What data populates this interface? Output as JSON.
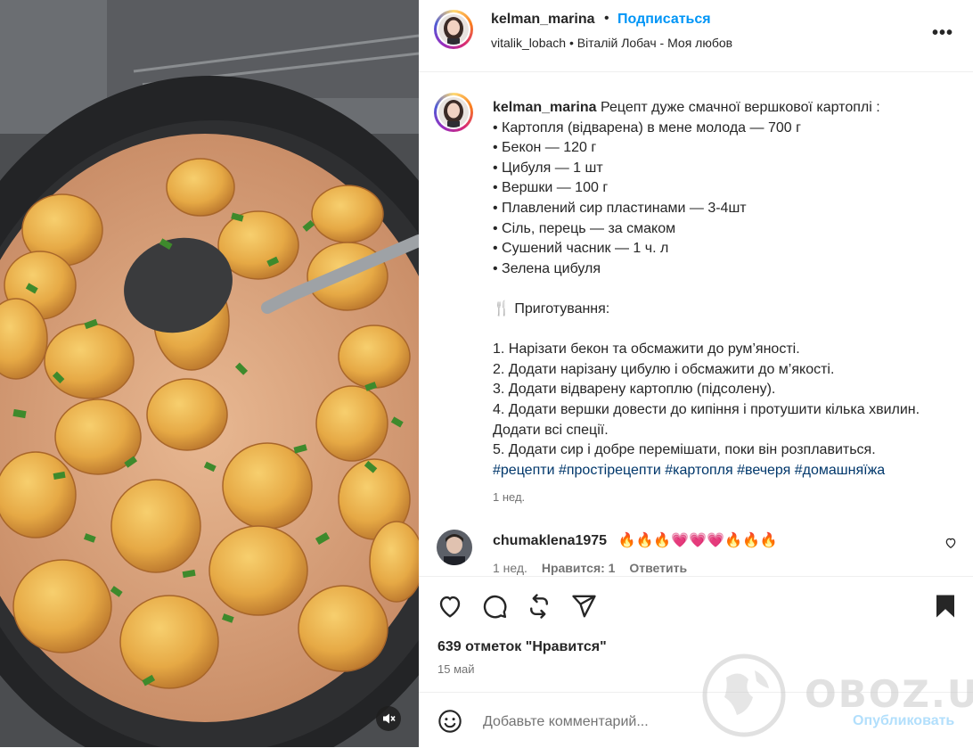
{
  "post": {
    "username": "kelman_marina",
    "separator": "•",
    "follow_label": "Подписаться",
    "audio": "vitalik_lobach • Віталій Лобач - Моя любов",
    "more_label": "•••"
  },
  "caption": {
    "username": "kelman_marina",
    "lines": [
      "Рецепт дуже смачної вершкової картоплі :",
      "• Картопля (відварена) в мене молода — 700 г",
      "• Бекон — 120 г",
      "• Цибуля — 1 шт",
      "• Вершки — 100 г",
      "• Плавлений сир пластинами — 3-4шт",
      "• Сіль, перець — за смаком",
      "• Сушений часник — 1 ч. л",
      "• Зелена цибуля",
      "",
      "🍴 Приготування:",
      "",
      "1. Нарізати бекон та обсмажити до рум’яності.",
      "2. Додати нарізану цибулю і обсмажити до м’якості.",
      "3. Додати відварену картоплю (підсолену).",
      "4. Додати вершки довести до кипіння і протушити кілька хвилин.",
      "Додати всі спеції.",
      "5. Додати сир і добре перемішати, поки він розплавиться."
    ],
    "hashtags": "#рецепти #простірецепти #картопля #вечеря #домашняїжа",
    "time": "1 нед."
  },
  "comment": {
    "username": "chumaklena1975",
    "text": "🔥🔥🔥💗💗💗🔥🔥🔥",
    "time": "1 нед.",
    "likes": "Нравится: 1",
    "reply": "Ответить"
  },
  "stats": {
    "likes": "639 отметок \"Нравится\"",
    "date": "15 май"
  },
  "add_comment": {
    "placeholder": "Добавьте комментарий...",
    "post_label": "Опубликовать"
  },
  "watermark": {
    "text": "OBOZ.UA"
  },
  "icons": [
    "heart-icon",
    "comment-icon",
    "share-icon",
    "send-icon",
    "bookmark-icon",
    "emoji-icon",
    "mute-icon",
    "more-icon"
  ]
}
